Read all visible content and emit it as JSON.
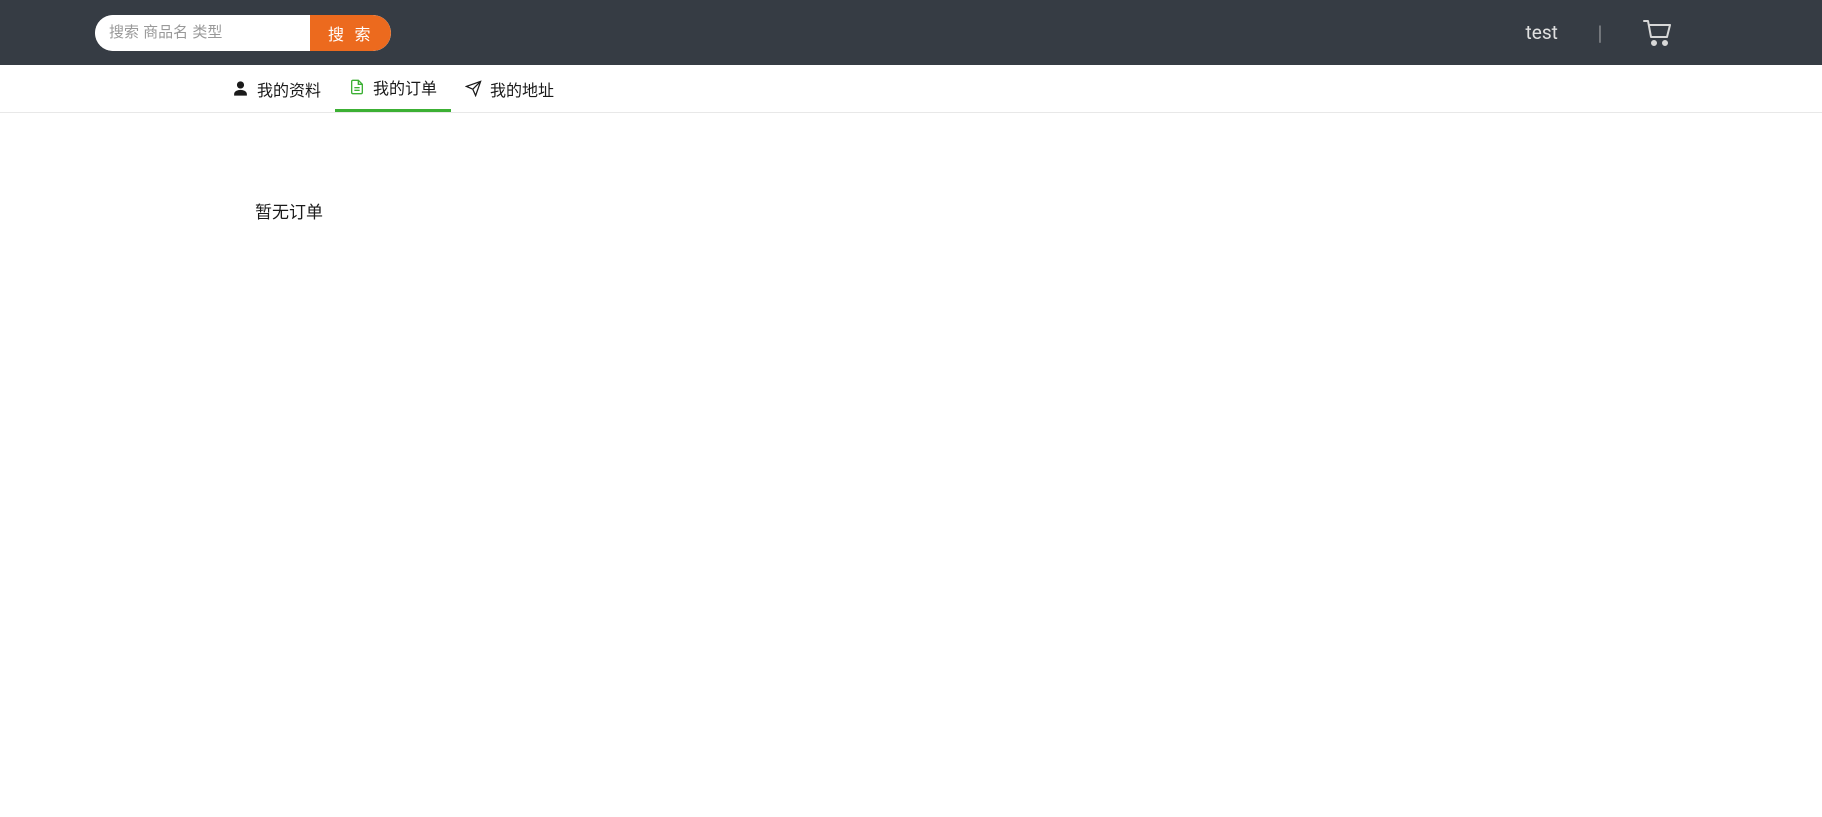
{
  "header": {
    "search_placeholder": "搜索 商品名 类型",
    "search_button": "搜 索",
    "username": "test",
    "divider": "|"
  },
  "tabs": [
    {
      "label": "我的资料"
    },
    {
      "label": "我的订单"
    },
    {
      "label": "我的地址"
    }
  ],
  "content": {
    "empty_message": "暂无订单"
  },
  "colors": {
    "header_bg": "#363c44",
    "accent_orange": "#ec6a1e",
    "tab_active": "#3cb034"
  }
}
